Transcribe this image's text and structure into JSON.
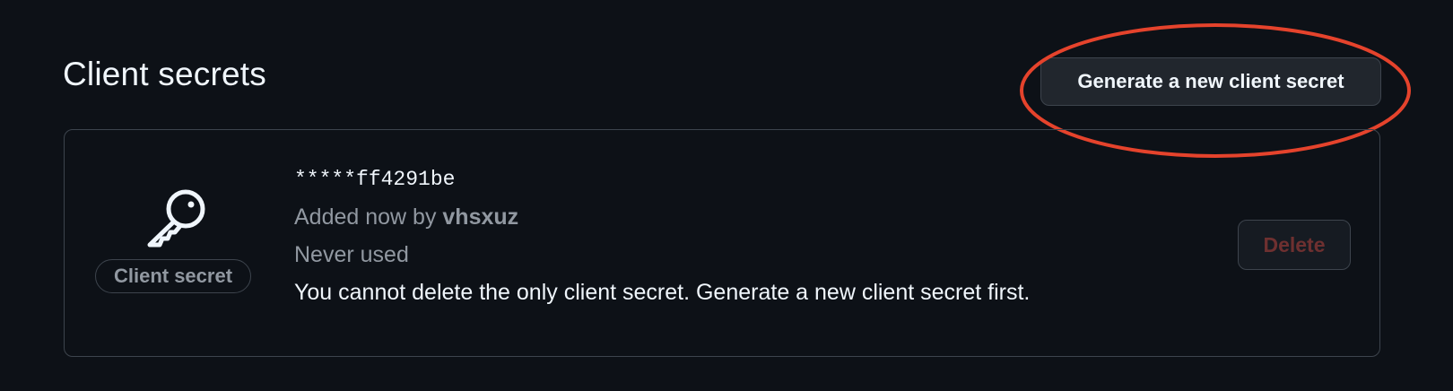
{
  "section": {
    "title": "Client secrets",
    "generate_button_label": "Generate a new client secret"
  },
  "secret": {
    "icon": "key-icon",
    "badge_label": "Client secret",
    "masked_value": "*****ff4291be",
    "added_prefix": "Added now by ",
    "added_by": "vhsxuz",
    "usage": "Never used",
    "warning": "You cannot delete the only client secret. Generate a new client secret first.",
    "delete_label": "Delete"
  },
  "colors": {
    "background": "#0d1117",
    "annotation_ellipse": "#e5432c",
    "delete_disabled_text": "#6e3030"
  }
}
